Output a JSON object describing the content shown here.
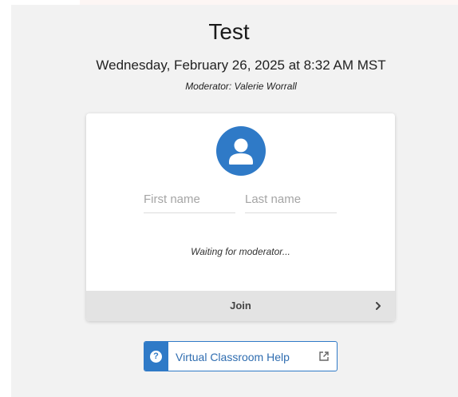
{
  "session": {
    "title": "Test",
    "datetime": "Wednesday, February 26, 2025 at 8:32 AM MST",
    "moderator": "Moderator: Valerie Worrall"
  },
  "form": {
    "avatar_icon": "user-icon",
    "first_name_placeholder": "First name",
    "last_name_placeholder": "Last name",
    "first_name_value": "",
    "last_name_value": "",
    "status_text": "Waiting for moderator...",
    "join_label": "Join",
    "join_icon": "chevron-right-icon"
  },
  "help": {
    "icon": "question-icon",
    "label": "Virtual Classroom Help",
    "external_icon": "external-link-icon"
  },
  "colors": {
    "accent": "#2f7ac7",
    "page_background": "#f2f2f2",
    "join_background": "#e3e3e3"
  }
}
